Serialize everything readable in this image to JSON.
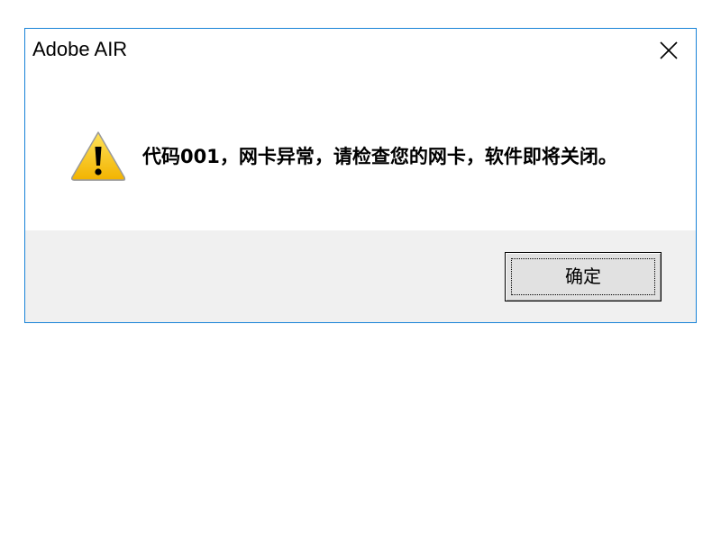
{
  "window": {
    "title": "Adobe AIR"
  },
  "message": {
    "text": "代码001，网卡异常，请检查您的网卡，软件即将关闭。"
  },
  "buttons": {
    "ok_label": "确定"
  },
  "icons": {
    "warning": "warning-triangle-icon",
    "close": "close-icon"
  },
  "colors": {
    "border": "#1883d7",
    "footer_bg": "#f0f0f0",
    "warning_yellow": "#f9c80e"
  }
}
